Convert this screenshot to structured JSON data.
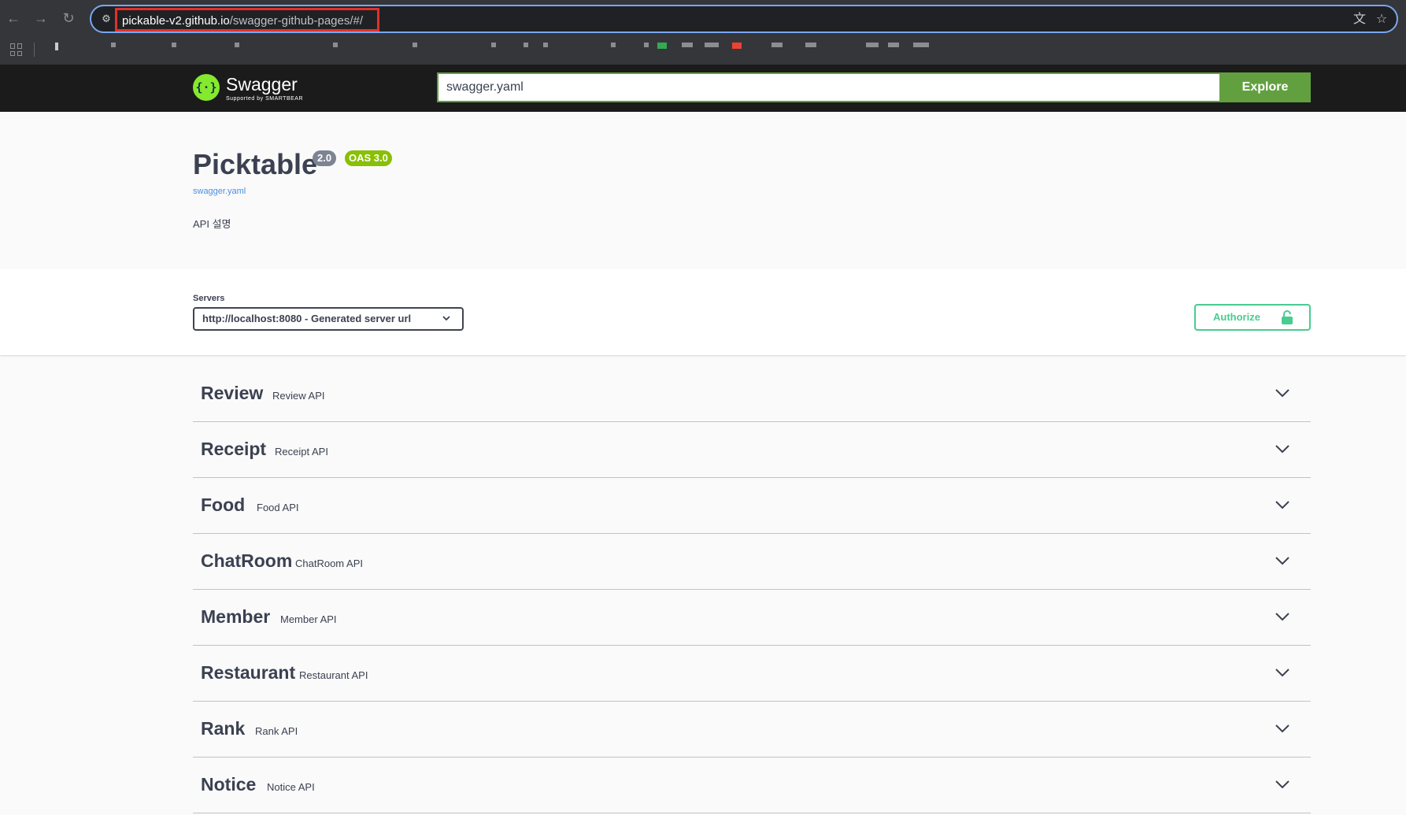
{
  "browser": {
    "url_host": "pickable-v2.github.io",
    "url_path": "/swagger-github-pages/#/",
    "back_icon": "arrow-left-icon",
    "forward_icon": "arrow-right-icon",
    "reload_icon": "reload-icon",
    "translate_icon": "translate-icon",
    "bookmark_icon": "star-icon"
  },
  "topbar": {
    "logo_mark": "{·}",
    "logo_word": "Swagger",
    "logo_sub": "Supported by SMARTBEAR",
    "spec_url": "swagger.yaml",
    "explore_label": "Explore",
    "accent": "#62a03f"
  },
  "info": {
    "title": "Picktable",
    "version": "2.0",
    "oas": "OAS 3.0",
    "spec_link": "swagger.yaml",
    "description": "API 설명"
  },
  "servers": {
    "label": "Servers",
    "selected": "http://localhost:8080 - Generated server url"
  },
  "authorize": {
    "label": "Authorize",
    "color": "#49cc90"
  },
  "tags": [
    {
      "name": "Review",
      "description": "Review API"
    },
    {
      "name": "Receipt",
      "description": "Receipt API"
    },
    {
      "name": "Food",
      "description": "Food API"
    },
    {
      "name": "ChatRoom",
      "description": "ChatRoom API"
    },
    {
      "name": "Member",
      "description": "Member API"
    },
    {
      "name": "Restaurant",
      "description": "Restaurant API"
    },
    {
      "name": "Rank",
      "description": "Rank API"
    },
    {
      "name": "Notice",
      "description": "Notice API"
    }
  ]
}
